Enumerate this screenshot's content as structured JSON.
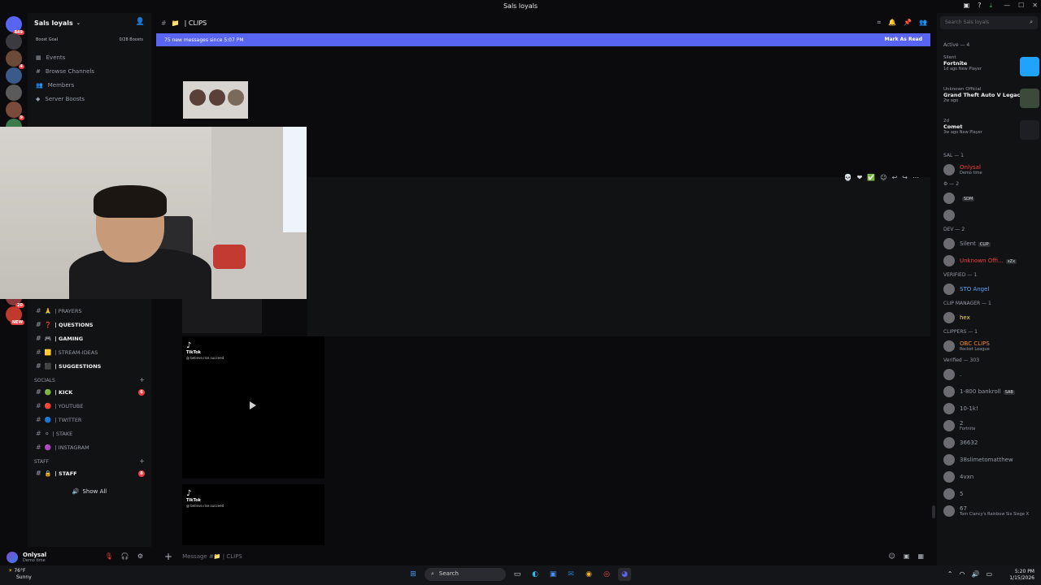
{
  "window": {
    "title": "Sals loyals"
  },
  "servers": [
    {
      "badge": "849"
    },
    {
      "badge": ""
    },
    {
      "badge": "4"
    },
    {
      "badge": ""
    },
    {
      "badge": ""
    },
    {
      "badge": "9"
    },
    {
      "badge": "31"
    },
    {
      "badge": "2"
    },
    {
      "badge": "37"
    },
    {
      "badge": ""
    },
    {
      "badge": ""
    },
    {
      "badge": ""
    },
    {
      "badge": ""
    },
    {
      "badge": "1"
    },
    {
      "badge": "62"
    },
    {
      "badge": ""
    },
    {
      "badge": "20"
    },
    {
      "badge": "NEW"
    }
  ],
  "sidebar": {
    "server_name": "Sals loyals",
    "boost_goal": "Boost Goal",
    "boosts": "0/28 Boosts",
    "menu": [
      {
        "label": "Events"
      },
      {
        "label": "Browse Channels"
      },
      {
        "label": "Members"
      },
      {
        "label": "Server Boosts"
      }
    ],
    "channels_top": [
      {
        "emoji": "🙏",
        "label": "| PRAYERS",
        "bold": false
      },
      {
        "emoji": "❓",
        "label": "| QUESTIONS",
        "bold": true
      },
      {
        "emoji": "🎮",
        "label": "| GAMING",
        "bold": true
      },
      {
        "emoji": "🟨",
        "label": "| STREAM-IDEAS",
        "bold": false
      },
      {
        "emoji": "⬛",
        "label": "| SUGGESTIONS",
        "bold": true
      }
    ],
    "socials_label": "SOCIALS",
    "socials": [
      {
        "emoji": "🟢",
        "label": "| KICK",
        "bold": true,
        "count": "6"
      },
      {
        "emoji": "🔴",
        "label": "| YOUTUBE",
        "bold": false,
        "count": ""
      },
      {
        "emoji": "🔵",
        "label": "| TWITTER",
        "bold": false,
        "count": ""
      },
      {
        "emoji": "⚪",
        "label": "| STAKE",
        "bold": false,
        "count": ""
      },
      {
        "emoji": "🟣",
        "label": "| INSTAGRAM",
        "bold": false,
        "count": ""
      }
    ],
    "staff_label": "STAFF",
    "staff": [
      {
        "emoji": "🔒",
        "label": "| STAFF",
        "bold": true,
        "count": "8"
      }
    ],
    "show_all": "Show All"
  },
  "user": {
    "name": "Onlysal",
    "status": "Demo time"
  },
  "chat": {
    "channel_name": "| CLIPS",
    "new_messages": "75 new messages since 5:07 PM",
    "mark_as_read": "Mark As Read",
    "tiktok_logo": "TikTok",
    "tiktok_handle": "@ believe.rise.succeed",
    "message_placeholder": "Message #📁 | CLIPS"
  },
  "members": {
    "search_placeholder": "Search Sals loyals",
    "activity_label": "Active — 4",
    "activities": [
      {
        "who": "Silent",
        "game": "Fortnite",
        "when": "1d ago  New Player",
        "color": "#1fa3ff"
      },
      {
        "who": "Unknown Official",
        "game": "Grand Theft Auto V Legacy",
        "when": "2w ago",
        "color": "#3b4a3a"
      },
      {
        "who": "2d",
        "game": "Comet",
        "when": "3w ago  New Player",
        "color": "#1e1f22"
      }
    ],
    "groups": [
      {
        "label": "SAL — 1",
        "members": [
          {
            "name": "Onlysal",
            "sub": "Demo time",
            "color": "#f23f43",
            "tag": ""
          }
        ]
      },
      {
        "label": "⚙ — 2",
        "members": [
          {
            "name": "",
            "sub": "",
            "color": "#949ba4",
            "tag": "SDM"
          },
          {
            "name": "",
            "sub": "",
            "color": "#949ba4",
            "tag": ""
          }
        ]
      },
      {
        "label": "DEV — 2",
        "members": [
          {
            "name": "Silent",
            "sub": "",
            "color": "#949ba4",
            "tag": "CLIP"
          },
          {
            "name": "Unknown Offi...",
            "sub": "",
            "color": "#f23f43",
            "tag": "xZx"
          }
        ]
      },
      {
        "label": "VERIFIED — 1",
        "members": [
          {
            "name": "STO Angel",
            "sub": "",
            "color": "#5aa9ff",
            "tag": ""
          }
        ]
      },
      {
        "label": "CLIP MANAGER — 1",
        "members": [
          {
            "name": "hex",
            "sub": "",
            "color": "#fadf3d",
            "tag": ""
          }
        ]
      },
      {
        "label": "CLIPPERS — 1",
        "members": [
          {
            "name": "OBC CLIPS",
            "sub": "Rocket League",
            "color": "#f08a2a",
            "tag": ""
          }
        ]
      },
      {
        "label": "Verified — 303",
        "members": [
          {
            "name": ".",
            "sub": "",
            "color": "#949ba4",
            "tag": ""
          },
          {
            "name": "1-800 bankroll",
            "sub": "",
            "color": "#949ba4",
            "tag": "SAB"
          },
          {
            "name": "10-1k!",
            "sub": "",
            "color": "#949ba4",
            "tag": ""
          },
          {
            "name": "2",
            "sub": "Fortnite",
            "color": "#949ba4",
            "tag": ""
          },
          {
            "name": "36632",
            "sub": "",
            "color": "#949ba4",
            "tag": ""
          },
          {
            "name": "38slimetomatthew",
            "sub": "",
            "color": "#949ba4",
            "tag": ""
          },
          {
            "name": "4vxn",
            "sub": "",
            "color": "#949ba4",
            "tag": ""
          },
          {
            "name": "5",
            "sub": "",
            "color": "#949ba4",
            "tag": ""
          },
          {
            "name": "67",
            "sub": "Tom Clancy's Rainbow Six Siege X",
            "color": "#949ba4",
            "tag": ""
          }
        ]
      }
    ]
  },
  "taskbar": {
    "weather_temp": "76°F",
    "weather_desc": "Sunny",
    "search_label": "Search",
    "time": "5:20 PM",
    "date": "1/15/2026"
  },
  "colors": {
    "accent": "#5865f2",
    "bg": "#0b0b0d",
    "panel": "#111214",
    "danger": "#f23f43"
  }
}
